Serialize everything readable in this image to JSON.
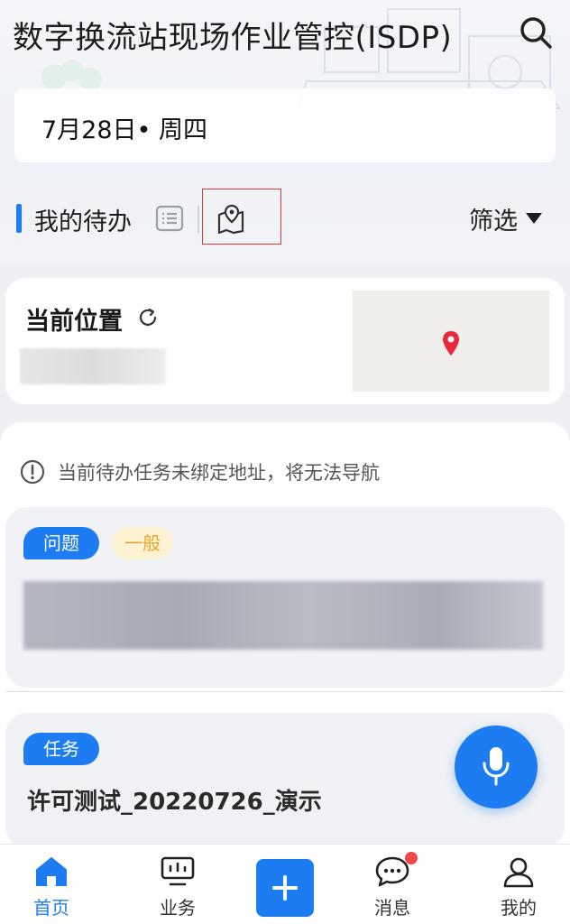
{
  "header": {
    "title": "数字换流站现场作业管控(ISDP)",
    "search_icon": "search-icon",
    "date": "7月28日• 周四"
  },
  "todo": {
    "title": "我的待办",
    "view_list_icon": "list-view-icon",
    "view_map_icon": "map-view-icon",
    "filter_label": "筛选"
  },
  "location": {
    "title": "当前位置",
    "refresh_icon": "refresh-icon",
    "marker_icon": "map-pin-icon"
  },
  "notice": {
    "text": "当前待办任务未绑定地址，将无法导航",
    "icon": "info-icon"
  },
  "tasks": [
    {
      "type": "问题",
      "level": "一般"
    },
    {
      "type": "任务",
      "name": "许可测试_20220726_演示"
    }
  ],
  "voice": {
    "icon": "microphone-icon"
  },
  "tabbar": {
    "items": [
      {
        "label": "首页",
        "icon": "home-icon"
      },
      {
        "label": "业务",
        "icon": "monitor-icon"
      },
      {
        "label": "",
        "icon": "plus-icon"
      },
      {
        "label": "消息",
        "icon": "chat-icon"
      },
      {
        "label": "我的",
        "icon": "user-icon"
      }
    ]
  },
  "colors": {
    "primary": "#1e7cf2",
    "highlight_box": "#e0353a",
    "level_text": "#e2a62f",
    "badge": "#f0484a"
  }
}
